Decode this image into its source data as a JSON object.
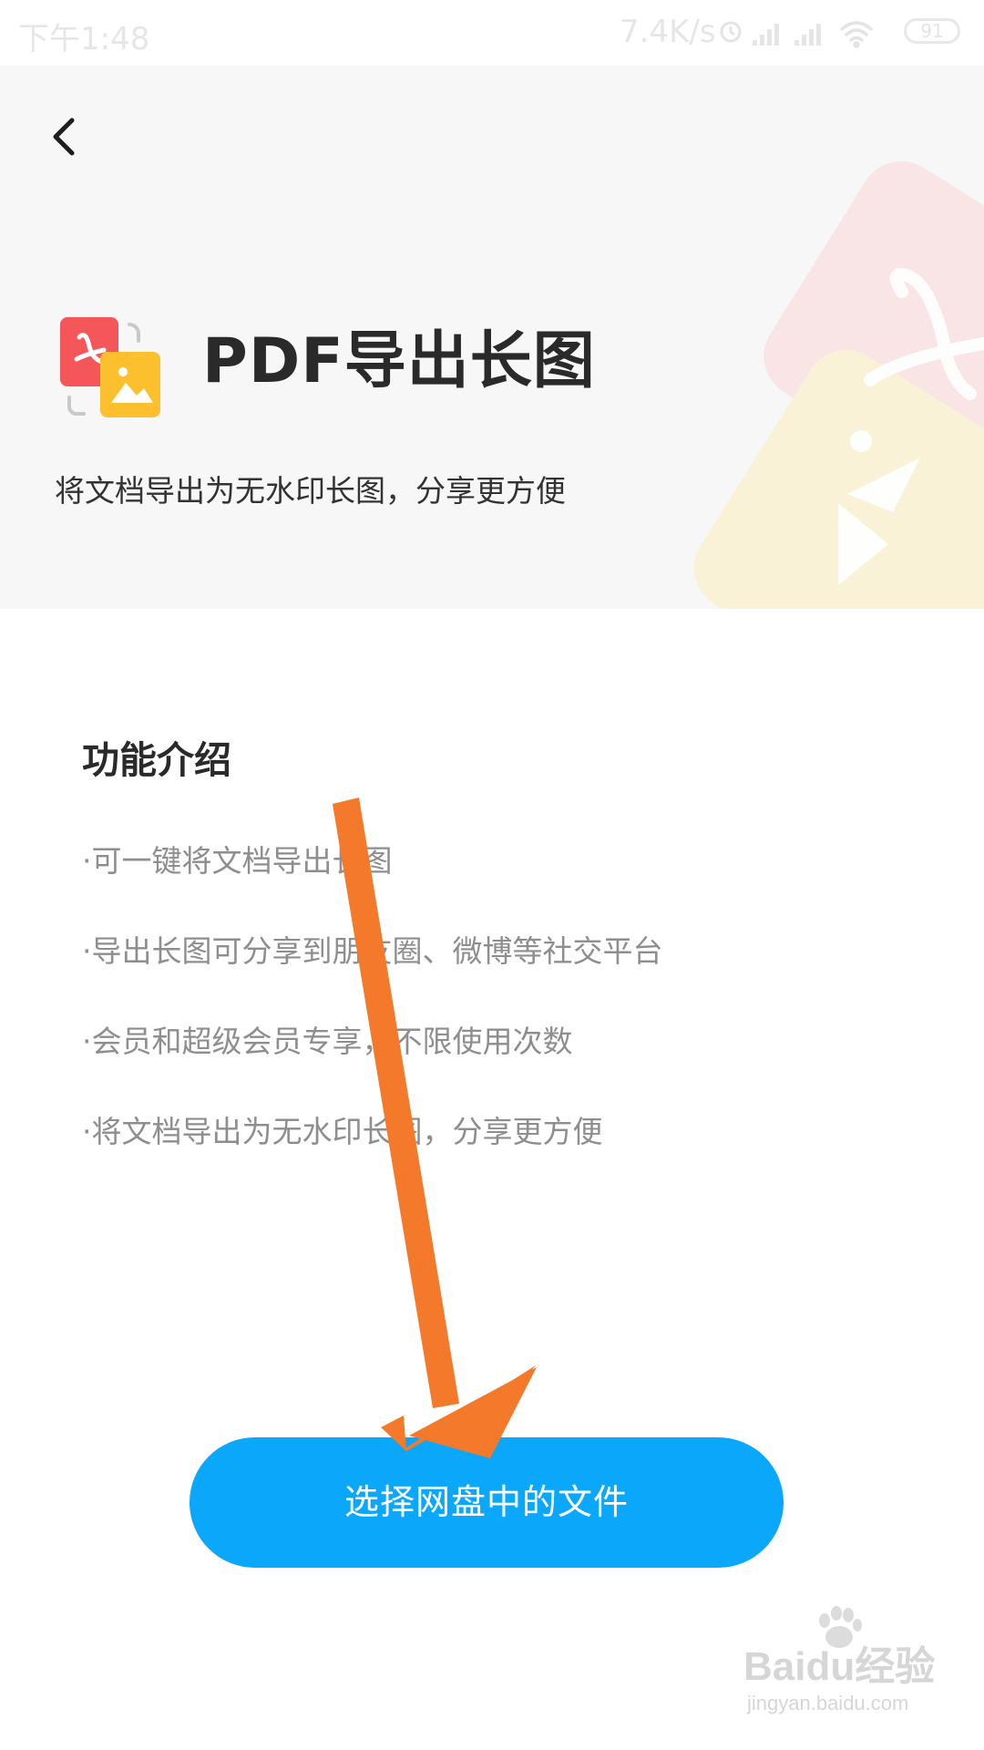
{
  "status_bar": {
    "time": "下午1:48",
    "network_speed": "7.4K/s",
    "battery": "91",
    "icons": [
      "alarm-icon",
      "signal-icon",
      "signal-icon",
      "wifi-icon",
      "battery-icon"
    ]
  },
  "header": {
    "back_icon": "chevron-left-icon",
    "title": "PDF导出长图",
    "subtitle": "将文档导出为无水印长图，分享更方便",
    "feature_icon": "pdf-to-image-icon"
  },
  "intro": {
    "title": "功能介绍",
    "items": [
      "·可一键将文档导出长图",
      "·导出长图可分享到朋友圈、微博等社交平台",
      "·会员和超级会员专享，不限使用次数",
      "·将文档导出为无水印长图，分享更方便"
    ]
  },
  "action": {
    "button_label": "选择网盘中的文件"
  },
  "annotation": {
    "arrow_color": "#f5792a"
  },
  "watermark": {
    "brand": "Baidu经验",
    "url": "jingyan.baidu.com"
  },
  "colors": {
    "accent": "#0ba7fb",
    "header_bg": "#f7f7f7",
    "pdf_red": "#f4565a",
    "image_yellow": "#fcc02f"
  }
}
